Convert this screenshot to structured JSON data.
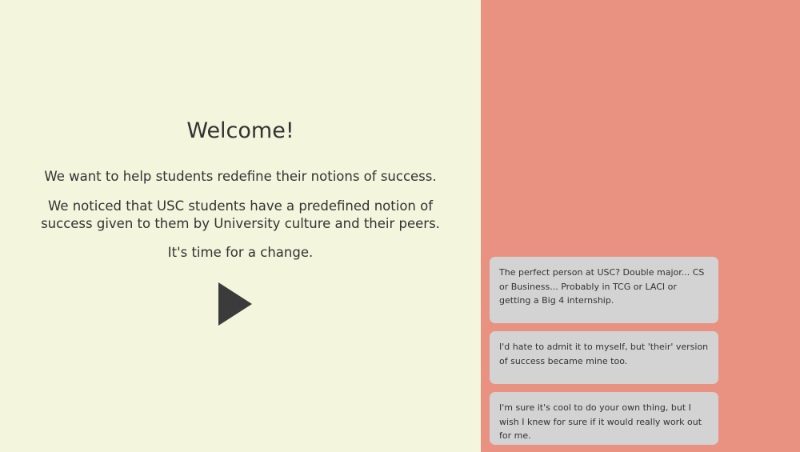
{
  "welcome": {
    "title": "Welcome!",
    "paragraph_1": "We want to help students redefine their notions of success.",
    "paragraph_2": "We noticed that USC students have a predefined notion of success given to them by University culture and their peers.",
    "paragraph_3": "It's time for a change.",
    "play_icon": "play-icon"
  },
  "quotes": [
    {
      "text": "The perfect person at USC? Double major... CS or Business... Probably in TCG or LACI or getting a Big 4 internship."
    },
    {
      "text": "I'd hate to admit it to myself, but 'their' version of success became mine too."
    },
    {
      "text": "I'm sure it's cool to do your own thing, but I wish I knew for sure if it would really work out for me."
    }
  ],
  "colors": {
    "left_background": "#f3f5dc",
    "right_background": "#e99282",
    "card_background": "#d3d3d3",
    "text": "#333333"
  }
}
